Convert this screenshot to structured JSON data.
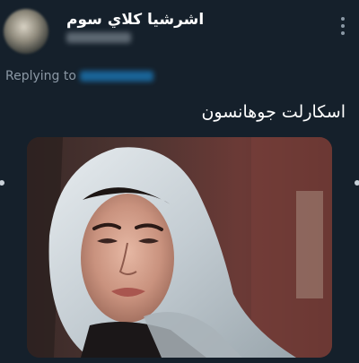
{
  "author": {
    "display_name": "اشرشيا كلاي سوم"
  },
  "reply": {
    "label": "Replying to"
  },
  "tweet": {
    "text": "اسكارلت جوهانسون"
  },
  "colors": {
    "background": "#15202b",
    "secondary_text": "#8b98a5",
    "accent": "#1d9bf0"
  },
  "icons": {
    "more": "more-vertical-icon"
  }
}
